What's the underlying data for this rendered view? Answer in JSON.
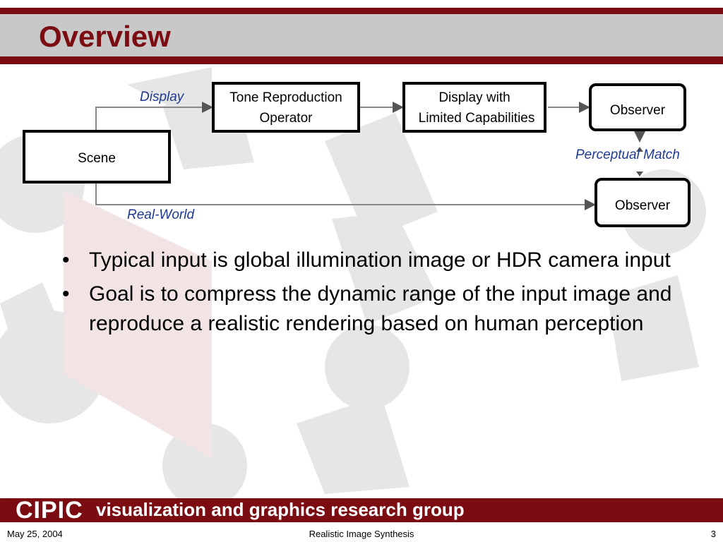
{
  "slide": {
    "title": "Overview",
    "bullets": [
      "Typical input is global illumination image or HDR camera input",
      "Goal is to compress the dynamic range of the input image and reproduce a realistic rendering based on human perception"
    ]
  },
  "diagram": {
    "nodes": {
      "scene": "Scene",
      "tone": [
        "Tone Reproduction",
        "Operator"
      ],
      "display": [
        "Display with",
        "Limited Capabilities"
      ],
      "observer_top": "Observer",
      "observer_bottom": "Observer"
    },
    "edge_labels": {
      "display": "Display",
      "real_world": "Real-World",
      "perceptual_match": "Perceptual Match"
    }
  },
  "footer": {
    "logo": "CIPIC",
    "group": "visualization and graphics research group",
    "date": "May 25, 2004",
    "course": "Realistic Image Synthesis",
    "page": "3"
  },
  "colors": {
    "brand": "#7a0c12",
    "title_band": "#c8c8c8",
    "label_blue": "#1f3a93"
  }
}
